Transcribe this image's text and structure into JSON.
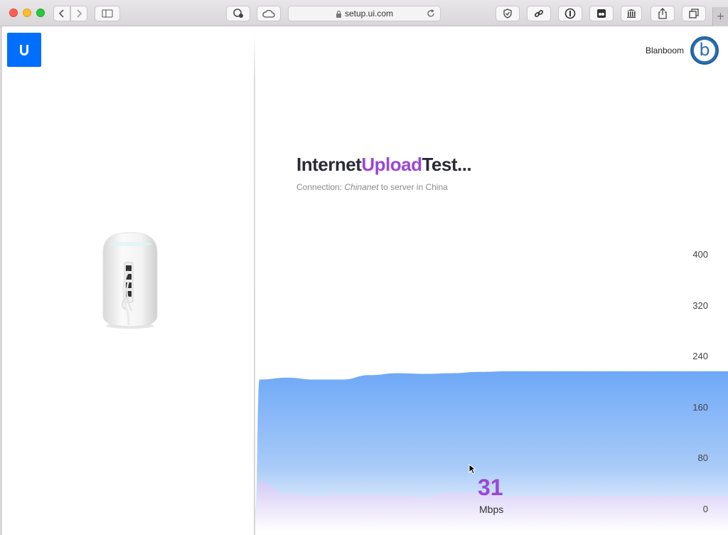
{
  "browser": {
    "url": "setup.ui.com",
    "toolbar_icons": [
      "back-icon",
      "forward-icon",
      "sidebar-icon",
      "privacy-icon",
      "cloud-icon",
      "shield-icon",
      "link-icon",
      "onepassword-icon",
      "extension-icon",
      "archive-icon",
      "share-icon",
      "tabs-icon",
      "new-tab-icon"
    ]
  },
  "header": {
    "logo_text": "U",
    "user_name": "Blanboom",
    "avatar_letter": "b"
  },
  "main": {
    "title_part1": "Internet",
    "title_accent": "Upload",
    "title_part2": "Test...",
    "subtitle_prefix": "Connection:",
    "subtitle_isp": "Chinanet",
    "subtitle_suffix": "to  server in China"
  },
  "speed": {
    "value": "31",
    "unit": "Mbps"
  },
  "colors": {
    "accent": "#9b47d6",
    "brand": "#006fff",
    "chart_blue": "#6ea8f7",
    "chart_purple": "#d9c8f5"
  },
  "chart_data": {
    "type": "area",
    "y_ticks": [
      "400",
      "320",
      "240",
      "160",
      "80",
      "0"
    ],
    "ylim": [
      0,
      400
    ],
    "series": [
      {
        "values": [
          0,
          205,
          208,
          205,
          205,
          212,
          215,
          214,
          215,
          217,
          218,
          218,
          218,
          218,
          218,
          218,
          218,
          218,
          218
        ]
      },
      {
        "values": [
          0,
          45,
          25,
          22,
          24,
          24,
          23,
          20,
          28,
          26,
          22,
          22,
          22,
          22,
          22,
          22,
          22,
          22,
          22
        ]
      }
    ]
  }
}
